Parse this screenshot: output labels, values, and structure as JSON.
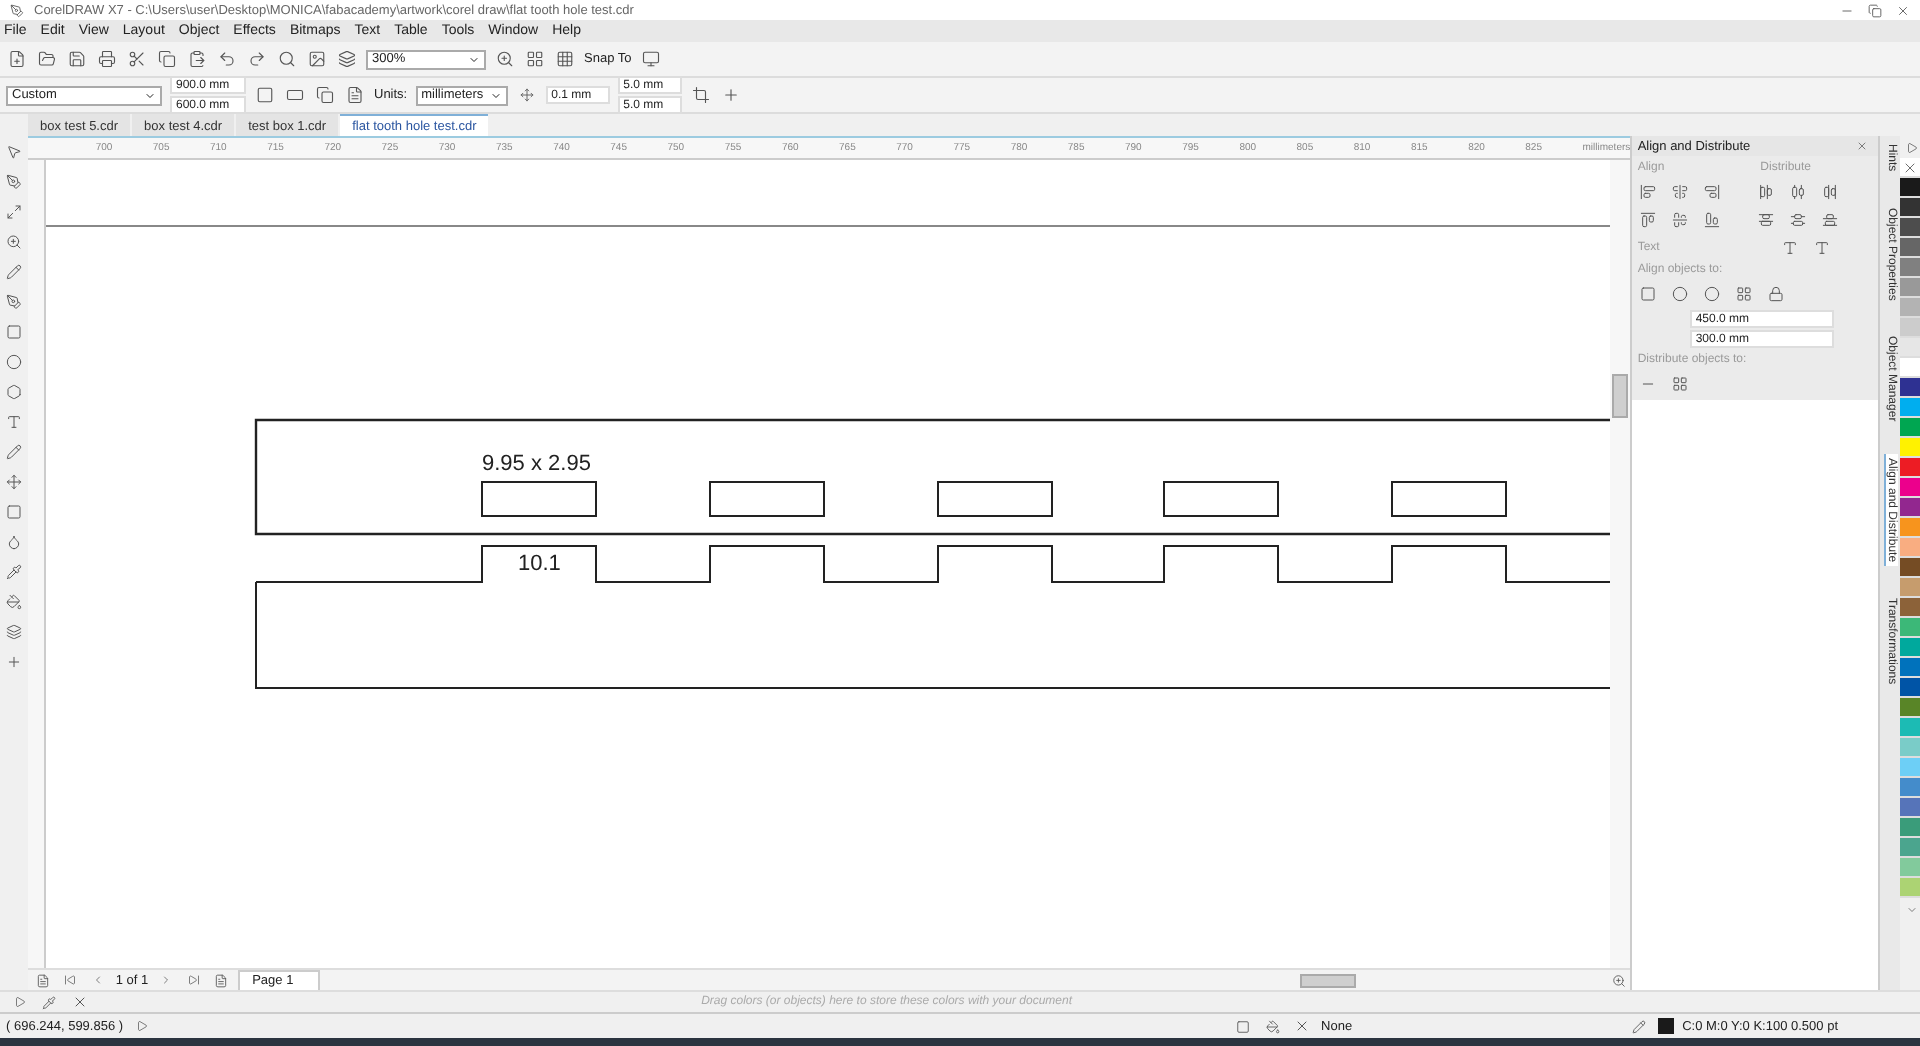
{
  "window": {
    "title": "CorelDRAW X7 - C:\\Users\\user\\Desktop\\MONICA\\fabacademy\\artwork\\corel draw\\flat tooth hole test.cdr"
  },
  "menu": [
    "File",
    "Edit",
    "View",
    "Layout",
    "Object",
    "Effects",
    "Bitmaps",
    "Text",
    "Table",
    "Tools",
    "Window",
    "Help"
  ],
  "toolbar": {
    "zoom": "300%",
    "snap": "Snap To"
  },
  "property_bar": {
    "preset": "Custom",
    "width": "900.0 mm",
    "height": "600.0 mm",
    "units_label": "Units:",
    "units": "millimeters",
    "nudge": "0.1 mm",
    "dup_x": "5.0 mm",
    "dup_y": "5.0 mm"
  },
  "doc_tabs": [
    {
      "label": "box test 5.cdr",
      "selected": false
    },
    {
      "label": "box test 4.cdr",
      "selected": false
    },
    {
      "label": "test box 1.cdr",
      "selected": false
    },
    {
      "label": "flat tooth hole test.cdr",
      "selected": true
    }
  ],
  "ruler": {
    "labels": [
      "700",
      "705",
      "710",
      "715",
      "720",
      "725",
      "730",
      "735",
      "740",
      "745",
      "750",
      "755",
      "760",
      "765",
      "770",
      "775",
      "780",
      "785",
      "790",
      "795",
      "800",
      "805",
      "810",
      "815",
      "820",
      "825"
    ],
    "unit": "millimeters"
  },
  "canvas": {
    "dimension": "9.95 x 2.95",
    "tooth": "10.1"
  },
  "page_nav": {
    "count": "1 of 1",
    "page": "Page 1"
  },
  "palette_hint": "Drag colors (or objects) here to store these colors with your document",
  "docker": {
    "title": "Align and Distribute",
    "align": "Align",
    "distribute": "Distribute",
    "text": "Text",
    "align_to": "Align objects to:",
    "x": "450.0 mm",
    "y": "300.0 mm",
    "distribute_to": "Distribute objects to:"
  },
  "side_tabs": [
    {
      "label": "Hints",
      "selected": false
    },
    {
      "label": "Object Properties",
      "selected": false
    },
    {
      "label": "Object Manager",
      "selected": false
    },
    {
      "label": "Align and Distribute",
      "selected": true
    },
    {
      "label": "Transformations",
      "selected": false
    }
  ],
  "palette": [
    {
      "color": "#1a1a1a"
    },
    {
      "color": "#333333"
    },
    {
      "color": "#4d4d4d"
    },
    {
      "color": "#666666"
    },
    {
      "color": "#808080"
    },
    {
      "color": "#999999"
    },
    {
      "color": "#b3b3b3"
    },
    {
      "color": "#cccccc"
    },
    {
      "color": "#e6e6e6"
    },
    {
      "color": "#ffffff"
    },
    {
      "color": "#2e3192"
    },
    {
      "color": "#00aeef"
    },
    {
      "color": "#00a651"
    },
    {
      "color": "#fff200"
    },
    {
      "color": "#ed1c24"
    },
    {
      "color": "#ec008c"
    },
    {
      "color": "#92278f"
    },
    {
      "color": "#f7941d"
    },
    {
      "color": "#f9ad81"
    },
    {
      "color": "#754c24"
    },
    {
      "color": "#c69c6d"
    },
    {
      "color": "#8c6239"
    },
    {
      "color": "#3cb878"
    },
    {
      "color": "#00a99d"
    },
    {
      "color": "#0072bc"
    },
    {
      "color": "#0054a6"
    },
    {
      "color": "#598527"
    },
    {
      "color": "#1cbbb4"
    },
    {
      "color": "#7accc8"
    },
    {
      "color": "#6dcff6"
    },
    {
      "color": "#448ccb"
    },
    {
      "color": "#5674b9"
    },
    {
      "color": "#3a9c7a"
    },
    {
      "color": "#4ba58e"
    },
    {
      "color": "#82ca9c"
    },
    {
      "color": "#acd373"
    }
  ],
  "status": {
    "coords": "( 696.244, 599.856 )",
    "fill": "None",
    "outline": "C:0 M:0 Y:0 K:100  0.500 pt"
  }
}
